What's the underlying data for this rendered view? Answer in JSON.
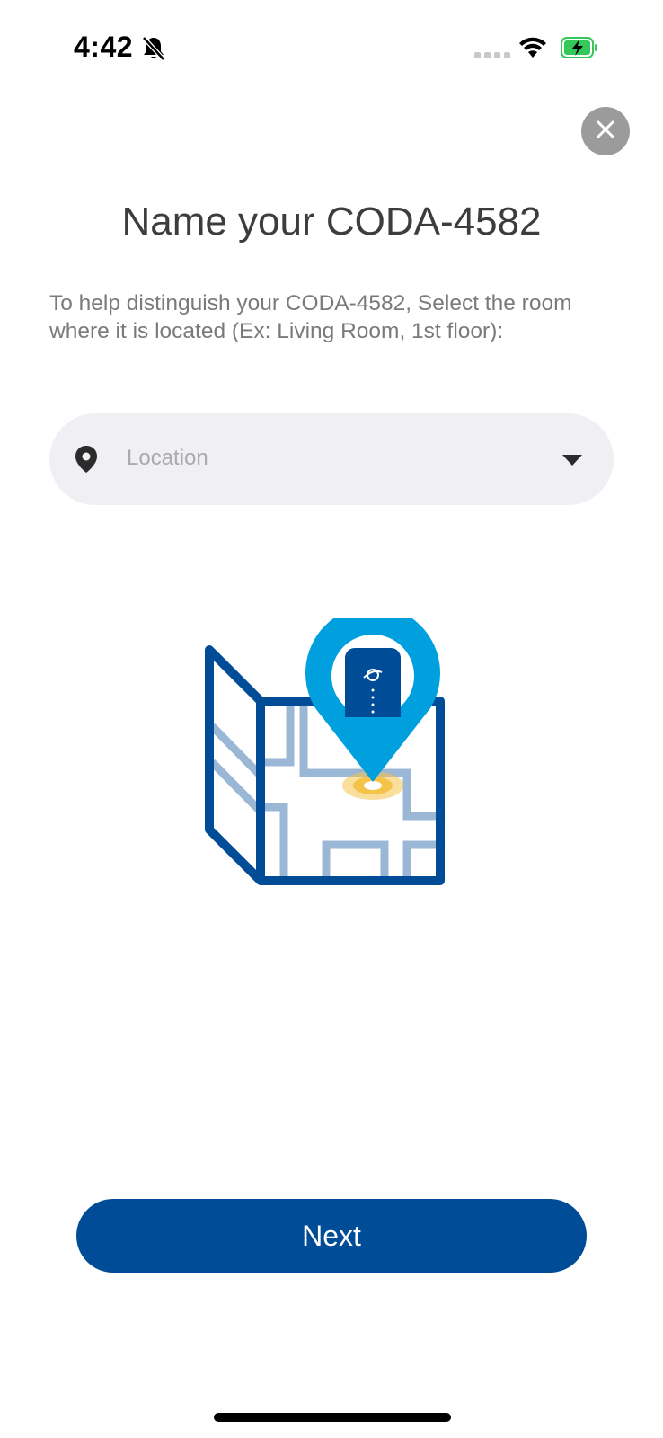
{
  "status_bar": {
    "time": "4:42",
    "icons": [
      "bell-slash-icon",
      "signal-icon",
      "wifi-icon",
      "battery-charging-icon"
    ]
  },
  "title": "Name your CODA-4582",
  "description": "To help distinguish your CODA-4582, Select the room where it is located (Ex: Living Room, 1st floor):",
  "location": {
    "placeholder": "Location",
    "icon": "location-pin-icon"
  },
  "next_button": {
    "label": "Next"
  },
  "colors": {
    "primary": "#004c97",
    "pin": "#00a0df",
    "map_light": "#9bb7d6",
    "highlight": "#f5c24a"
  }
}
